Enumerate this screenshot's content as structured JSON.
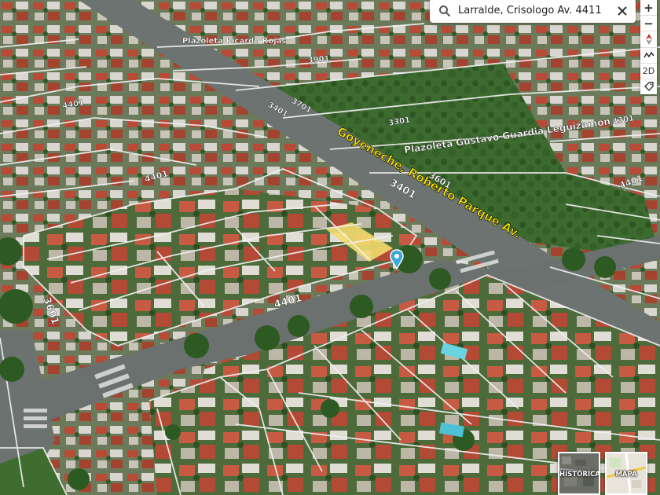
{
  "search": {
    "value": "Larralde, Crisologo Av. 4411",
    "search_icon": "search-icon",
    "clear_icon": "close-icon"
  },
  "map_labels": {
    "street_main": "Goyeneche, Roberto Parque Av.",
    "street_cross": "4401",
    "plaza": "Plazoleta Gustavo Guardia Leguizamon",
    "address_3601": "3601",
    "address_3401": "3401",
    "address_3601b": "3601",
    "address_4401b": "4401",
    "address_4401c": "4401",
    "address_4301": "4301",
    "address_4401d": "4401",
    "address_3901": "3901",
    "address_3701": "3701",
    "address_3301": "3301",
    "address_3401b": "3401",
    "plaza_top": "Plazoleta Ricardo Rojas"
  },
  "controls": {
    "zoom_in": "+",
    "zoom_out": "−",
    "mode_2d": "2D",
    "icons": [
      "plus-icon",
      "minus-icon",
      "compass-icon",
      "tilt-icon",
      "2d-label",
      "tag-icon"
    ]
  },
  "thumbnails": {
    "historica": "HISTÓRICA",
    "mapa": "MAPA"
  },
  "colors": {
    "parcel_line": "#f2f2f2",
    "highlight_parcel": "#f3dc6e",
    "pin": "#3aa8d8",
    "street_label": "#f6e300",
    "road": "#6c7370",
    "vegetation": "#3b6b2c"
  }
}
